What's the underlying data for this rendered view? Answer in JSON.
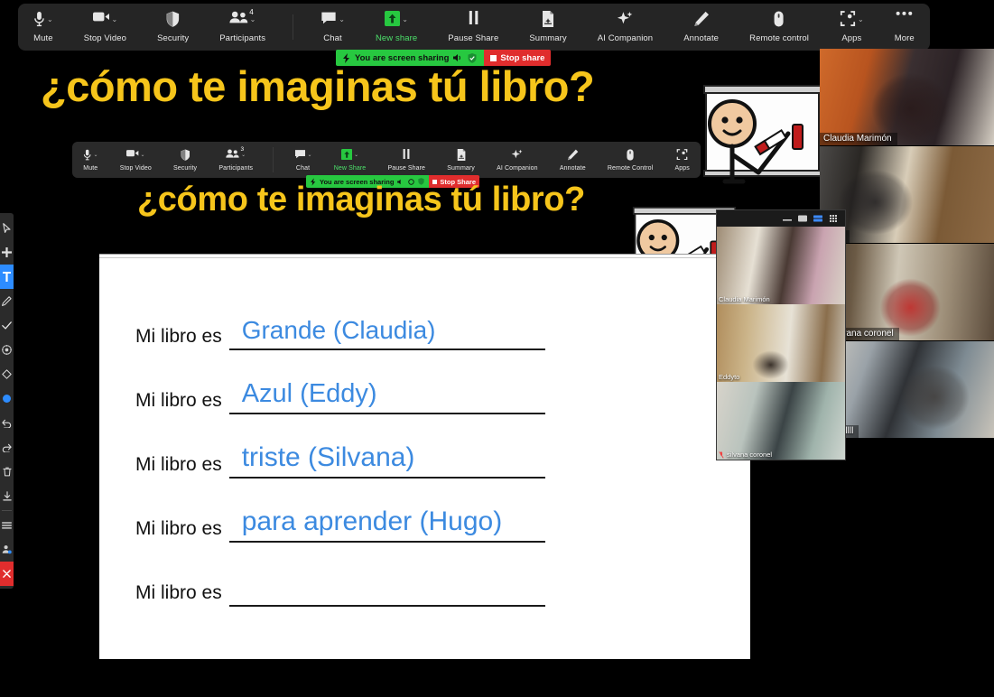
{
  "app": {
    "name": "Zoom",
    "state": "screen-sharing"
  },
  "toolbar": {
    "items": [
      {
        "label": "Mute",
        "icon": "microphone-icon",
        "caret": true,
        "badge": null,
        "highlight": false
      },
      {
        "label": "Stop Video",
        "icon": "video-camera-icon",
        "caret": true,
        "badge": null,
        "highlight": false
      },
      {
        "label": "Security",
        "icon": "shield-icon",
        "caret": false,
        "badge": null,
        "highlight": false
      },
      {
        "label": "Participants",
        "icon": "participants-icon",
        "caret": true,
        "badge": "4",
        "highlight": false
      },
      {
        "label": "Chat",
        "icon": "chat-bubble-icon",
        "caret": true,
        "badge": null,
        "highlight": false
      },
      {
        "label": "New share",
        "icon": "share-screen-icon",
        "caret": true,
        "badge": null,
        "highlight": true
      },
      {
        "label": "Pause Share",
        "icon": "pause-icon",
        "caret": false,
        "badge": null,
        "highlight": false
      },
      {
        "label": "Summary",
        "icon": "summary-doc-icon",
        "caret": false,
        "badge": null,
        "highlight": false
      },
      {
        "label": "AI Companion",
        "icon": "sparkle-icon",
        "caret": false,
        "badge": null,
        "highlight": false
      },
      {
        "label": "Annotate",
        "icon": "pencil-icon",
        "caret": false,
        "badge": null,
        "highlight": false
      },
      {
        "label": "Remote control",
        "icon": "mouse-icon",
        "caret": false,
        "badge": null,
        "highlight": false
      },
      {
        "label": "Apps",
        "icon": "apps-icon",
        "caret": true,
        "badge": null,
        "highlight": false
      },
      {
        "label": "More",
        "icon": "more-dots-icon",
        "caret": false,
        "badge": null,
        "highlight": false
      }
    ]
  },
  "share_banner": {
    "status_text": "You are screen sharing",
    "stop_label": "Stop share",
    "green": "#27c840",
    "red": "#e02d2d"
  },
  "inner_toolbar": {
    "items": [
      {
        "label": "Mute",
        "icon": "microphone-icon",
        "caret": true,
        "badge": null,
        "highlight": false
      },
      {
        "label": "Stop Video",
        "icon": "video-camera-icon",
        "caret": true,
        "badge": null,
        "highlight": false
      },
      {
        "label": "Security",
        "icon": "shield-icon",
        "caret": false,
        "badge": null,
        "highlight": false
      },
      {
        "label": "Participants",
        "icon": "participants-icon",
        "caret": true,
        "badge": "3",
        "highlight": false
      },
      {
        "label": "Chat",
        "icon": "chat-bubble-icon",
        "caret": true,
        "badge": null,
        "highlight": false
      },
      {
        "label": "New Share",
        "icon": "share-screen-icon",
        "caret": true,
        "badge": null,
        "highlight": true
      },
      {
        "label": "Pause Share",
        "icon": "pause-icon",
        "caret": false,
        "badge": null,
        "highlight": false
      },
      {
        "label": "Summary",
        "icon": "summary-doc-icon",
        "caret": false,
        "badge": null,
        "highlight": false
      },
      {
        "label": "AI Companion",
        "icon": "sparkle-icon",
        "caret": false,
        "badge": null,
        "highlight": false
      },
      {
        "label": "Annotate",
        "icon": "pencil-icon",
        "caret": false,
        "badge": null,
        "highlight": false
      },
      {
        "label": "Remote Control",
        "icon": "mouse-icon",
        "caret": false,
        "badge": null,
        "highlight": false
      },
      {
        "label": "Apps",
        "icon": "apps-icon",
        "caret": false,
        "badge": null,
        "highlight": false
      }
    ]
  },
  "inner_share_banner": {
    "status_text": "You are screen sharing",
    "stop_label": "Stop Share"
  },
  "slide": {
    "title": "¿cómo te imaginas tú libro?",
    "title_color": "#f6c51b",
    "nested_title": "¿cómo te imaginas tú libro?",
    "answer_color": "#3c8ae0",
    "prompt": "Mi libro es",
    "lines": [
      {
        "prompt": "Mi libro es",
        "answer": "Grande   (Claudia)"
      },
      {
        "prompt": "Mi libro es",
        "answer": "Azul  (Eddy)"
      },
      {
        "prompt": "Mi libro es",
        "answer": "triste (Silvana)"
      },
      {
        "prompt": "Mi libro es",
        "answer": "para aprender  (Hugo)"
      },
      {
        "prompt": "Mi libro es",
        "answer": ""
      }
    ]
  },
  "annotation_toolbar": {
    "items": [
      {
        "name": "select-cursor-tool",
        "icon": "cursor-arrow-icon",
        "active": false
      },
      {
        "name": "move-tool",
        "icon": "move-cross-icon",
        "active": false
      },
      {
        "name": "text-tool",
        "icon": "text-t-icon",
        "active": true
      },
      {
        "name": "draw-pen-tool",
        "icon": "pencil-icon",
        "active": false
      },
      {
        "name": "stamp-check-tool",
        "icon": "check-mark-icon",
        "active": false
      },
      {
        "name": "spotlight-tool",
        "icon": "spotlight-icon",
        "active": false
      },
      {
        "name": "eraser-tool",
        "icon": "eraser-diamond-icon",
        "active": false
      },
      {
        "name": "color-picker",
        "icon": "blue-color-dot-icon",
        "active": false
      },
      {
        "name": "undo-button",
        "icon": "undo-arrow-icon",
        "active": false
      },
      {
        "name": "redo-button",
        "icon": "redo-arrow-icon",
        "active": false
      },
      {
        "name": "clear-button",
        "icon": "trash-can-icon",
        "active": false
      },
      {
        "name": "save-button",
        "icon": "download-save-icon",
        "active": false
      },
      {
        "name": "format-lines-button",
        "icon": "lines-format-icon",
        "active": false
      },
      {
        "name": "annotator-name-button",
        "icon": "person-badge-icon",
        "active": false
      },
      {
        "name": "close-annotation-button",
        "icon": "close-x-icon",
        "active": false
      }
    ]
  },
  "participants_strip": {
    "tiles": [
      {
        "name": "Claudia Marimón",
        "muted": false
      },
      {
        "name": "Eddy",
        "muted": false
      },
      {
        "name": "silvana coronel",
        "muted": true
      },
      {
        "name": "Abrilllllll",
        "muted": false
      }
    ]
  },
  "nested_participants_strip": {
    "view_buttons": [
      "minimize-icon",
      "speaker-view-icon",
      "side-by-side-icon",
      "gallery-view-icon"
    ],
    "active_view": "side-by-side-icon",
    "tiles": [
      {
        "name": "Claudia Marimón",
        "muted": false
      },
      {
        "name": "Eddyto",
        "muted": false
      },
      {
        "name": "silvana coronel",
        "muted": true
      }
    ]
  }
}
